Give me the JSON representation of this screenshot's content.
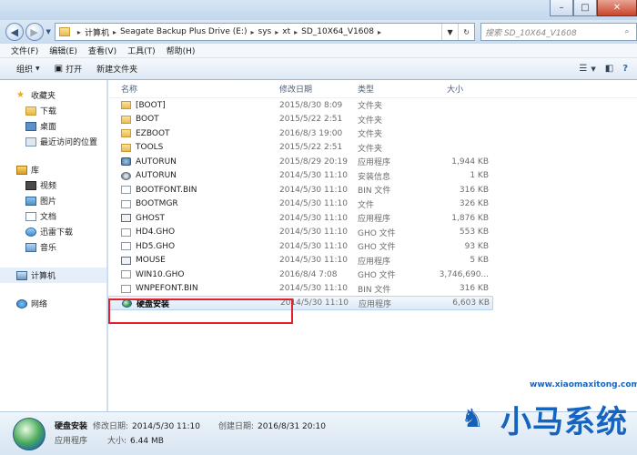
{
  "window": {
    "controls": [
      "–",
      "□",
      "✕"
    ]
  },
  "address": {
    "crumbs": [
      "计算机",
      "Seagate Backup Plus Drive (E:)",
      "sys",
      "xt",
      "SD_10X64_V1608"
    ],
    "search_placeholder": "搜索 SD_10X64_V1608"
  },
  "menu": [
    "文件(F)",
    "编辑(E)",
    "查看(V)",
    "工具(T)",
    "帮助(H)"
  ],
  "toolbar": {
    "organize": "组织",
    "open": "打开",
    "new_folder": "新建文件夹"
  },
  "nav": {
    "favorites": {
      "label": "收藏夹",
      "items": [
        "下载",
        "桌面",
        "最近访问的位置"
      ]
    },
    "libraries": {
      "label": "库",
      "items": [
        "视频",
        "图片",
        "文档",
        "迅雷下载",
        "音乐"
      ]
    },
    "computer": "计算机",
    "network": "网络"
  },
  "columns": {
    "name": "名称",
    "date": "修改日期",
    "type": "类型",
    "size": "大小"
  },
  "files": [
    {
      "name": "[BOOT]",
      "date": "2015/8/30 8:09",
      "type": "文件夹",
      "size": "",
      "icon": "folder-icon"
    },
    {
      "name": "BOOT",
      "date": "2015/5/22 2:51",
      "type": "文件夹",
      "size": "",
      "icon": "folder-icon"
    },
    {
      "name": "EZBOOT",
      "date": "2016/8/3 19:00",
      "type": "文件夹",
      "size": "",
      "icon": "folder-icon"
    },
    {
      "name": "TOOLS",
      "date": "2015/5/22 2:51",
      "type": "文件夹",
      "size": "",
      "icon": "folder-icon"
    },
    {
      "name": "AUTORUN",
      "date": "2015/8/29 20:19",
      "type": "应用程序",
      "size": "1,944 KB",
      "icon": "app-icon"
    },
    {
      "name": "AUTORUN",
      "date": "2014/5/30 11:10",
      "type": "安装信息",
      "size": "1 KB",
      "icon": "gear-icon"
    },
    {
      "name": "BOOTFONT.BIN",
      "date": "2014/5/30 11:10",
      "type": "BIN 文件",
      "size": "316 KB",
      "icon": "doc-icon"
    },
    {
      "name": "BOOTMGR",
      "date": "2014/5/30 11:10",
      "type": "文件",
      "size": "326 KB",
      "icon": "doc-icon"
    },
    {
      "name": "GHOST",
      "date": "2014/5/30 11:10",
      "type": "应用程序",
      "size": "1,876 KB",
      "icon": "ghost-icon"
    },
    {
      "name": "HD4.GHO",
      "date": "2014/5/30 11:10",
      "type": "GHO 文件",
      "size": "553 KB",
      "icon": "doc-icon"
    },
    {
      "name": "HD5.GHO",
      "date": "2014/5/30 11:10",
      "type": "GHO 文件",
      "size": "93 KB",
      "icon": "doc-icon"
    },
    {
      "name": "MOUSE",
      "date": "2014/5/30 11:10",
      "type": "应用程序",
      "size": "5 KB",
      "icon": "ghost-icon"
    },
    {
      "name": "WIN10.GHO",
      "date": "2016/8/4 7:08",
      "type": "GHO 文件",
      "size": "3,746,690...",
      "icon": "doc-icon"
    },
    {
      "name": "WNPEFONT.BIN",
      "date": "2014/5/30 11:10",
      "type": "BIN 文件",
      "size": "316 KB",
      "icon": "doc-icon"
    },
    {
      "name": "硬盘安装",
      "date": "2014/5/30 11:10",
      "type": "应用程序",
      "size": "6,603 KB",
      "icon": "disk-icon",
      "selected": true
    }
  ],
  "details": {
    "name": "硬盘安装",
    "type": "应用程序",
    "modified_label": "修改日期:",
    "modified": "2014/5/30 11:10",
    "created_label": "创建日期:",
    "created": "2016/8/31 20:10",
    "size_label": "大小:",
    "size": "6.44 MB"
  },
  "watermark": {
    "text": "小马系统",
    "url": "www.xiaomaxitong.com"
  }
}
